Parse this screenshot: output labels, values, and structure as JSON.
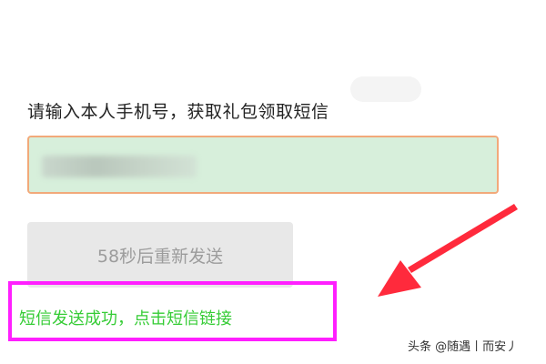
{
  "form": {
    "prompt": "请输入本人手机号，获取礼包领取短信",
    "resend_label": "58秒后重新发送"
  },
  "annotation": {
    "success_text": "短信发送成功，点击短信链接",
    "highlight_color": "#ff1fff",
    "arrow_color": "#ff2a3c",
    "arrow_icon": "red-arrow-icon"
  },
  "watermark": {
    "text": "头条 @随遇丨而安丿"
  },
  "colors": {
    "input_background": "#d7efdb",
    "input_border": "#f2a97a",
    "button_background": "#e8e8e8",
    "button_text": "#9c9c9c",
    "success_text": "#36cc36"
  }
}
